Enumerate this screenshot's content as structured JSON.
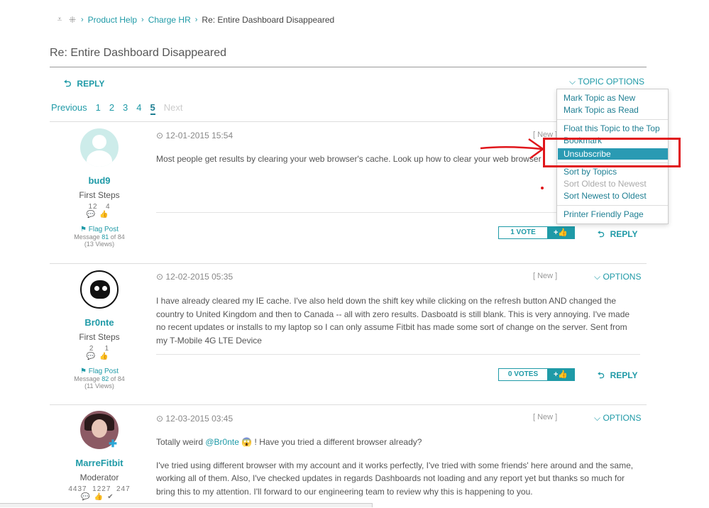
{
  "breadcrumb": {
    "items": [
      "Product Help",
      "Charge HR",
      "Re: Entire Dashboard Disappeared"
    ]
  },
  "page_title": "Re: Entire Dashboard Disappeared",
  "toolbar": {
    "reply_label": "REPLY",
    "topic_options_label": "TOPIC OPTIONS"
  },
  "pager": {
    "previous": "Previous",
    "pages": [
      "1",
      "2",
      "3",
      "4",
      "5"
    ],
    "current": "5",
    "next": "Next"
  },
  "topic_menu": {
    "items": [
      {
        "label": "Mark Topic as New",
        "enabled": true
      },
      {
        "label": "Mark Topic as Read",
        "enabled": true
      },
      {
        "label": "Float this Topic to the Top",
        "enabled": true
      },
      {
        "label": "Bookmark",
        "enabled": true
      },
      {
        "label": "Unsubscribe",
        "enabled": true,
        "highlighted": true
      },
      {
        "label": "Sort by Topics",
        "enabled": true
      },
      {
        "label": "Sort Oldest to Newest",
        "enabled": false
      },
      {
        "label": "Sort Newest to Oldest",
        "enabled": true
      },
      {
        "label": "Printer Friendly Page",
        "enabled": true
      }
    ]
  },
  "posts": [
    {
      "author": "bud9",
      "rank": "First Steps",
      "stats": [
        "12",
        "4"
      ],
      "flag_label": "Flag Post",
      "message_prefix": "Message",
      "message_num": "81",
      "message_suffix": "of 84",
      "views": "(13 Views)",
      "date": "12-01-2015 15:54",
      "new_tag": "[ New ]",
      "options_label": "OPTIONS",
      "body": [
        "Most people get results by clearing your web browser's cache. Look up how to clear your web browser"
      ],
      "votes": "1 VOTE",
      "reply_label": "REPLY"
    },
    {
      "author": "Br0nte",
      "rank": "First Steps",
      "stats": [
        "2",
        "1"
      ],
      "flag_label": "Flag Post",
      "message_prefix": "Message",
      "message_num": "82",
      "message_suffix": "of 84",
      "views": "(11 Views)",
      "date": "12-02-2015 05:35",
      "new_tag": "[ New ]",
      "options_label": "OPTIONS",
      "body": [
        "I have already cleared my IE cache. I've also held down the shift key while clicking on the refresh button AND changed the country to United Kingdom and then to Canada -- all with zero results. Dasboatd is still blank. This is very annoying. I've made no recent updates or installs to my laptop so I can only assume Fitbit has made some sort of change on the server. Sent from my T-Mobile 4G LTE Device"
      ],
      "votes": "0 VOTES",
      "reply_label": "REPLY"
    },
    {
      "author": "MarreFitbit",
      "rank": "Moderator",
      "stats": [
        "4437",
        "1227",
        "247"
      ],
      "date": "12-03-2015 03:45",
      "new_tag": "[ New ]",
      "options_label": "OPTIONS",
      "body_intro": "Totally weird ",
      "body_mention": "@Br0nte",
      "body_after": " ! Have you tried a different browser already?",
      "body": [
        "I've tried using different browser with my account and it works perfectly, I've tried with some friends' here around and the same, working all of them. Also, I've checked updates in regards Dashboards not loading and any report yet but thanks so much for bring this to my attention. I'll forward to our engineering team to review why this is happening to you."
      ]
    }
  ],
  "colors": {
    "accent": "#1f9aa7",
    "highlight": "#2a9ab3",
    "annotation": "#e0161b"
  }
}
